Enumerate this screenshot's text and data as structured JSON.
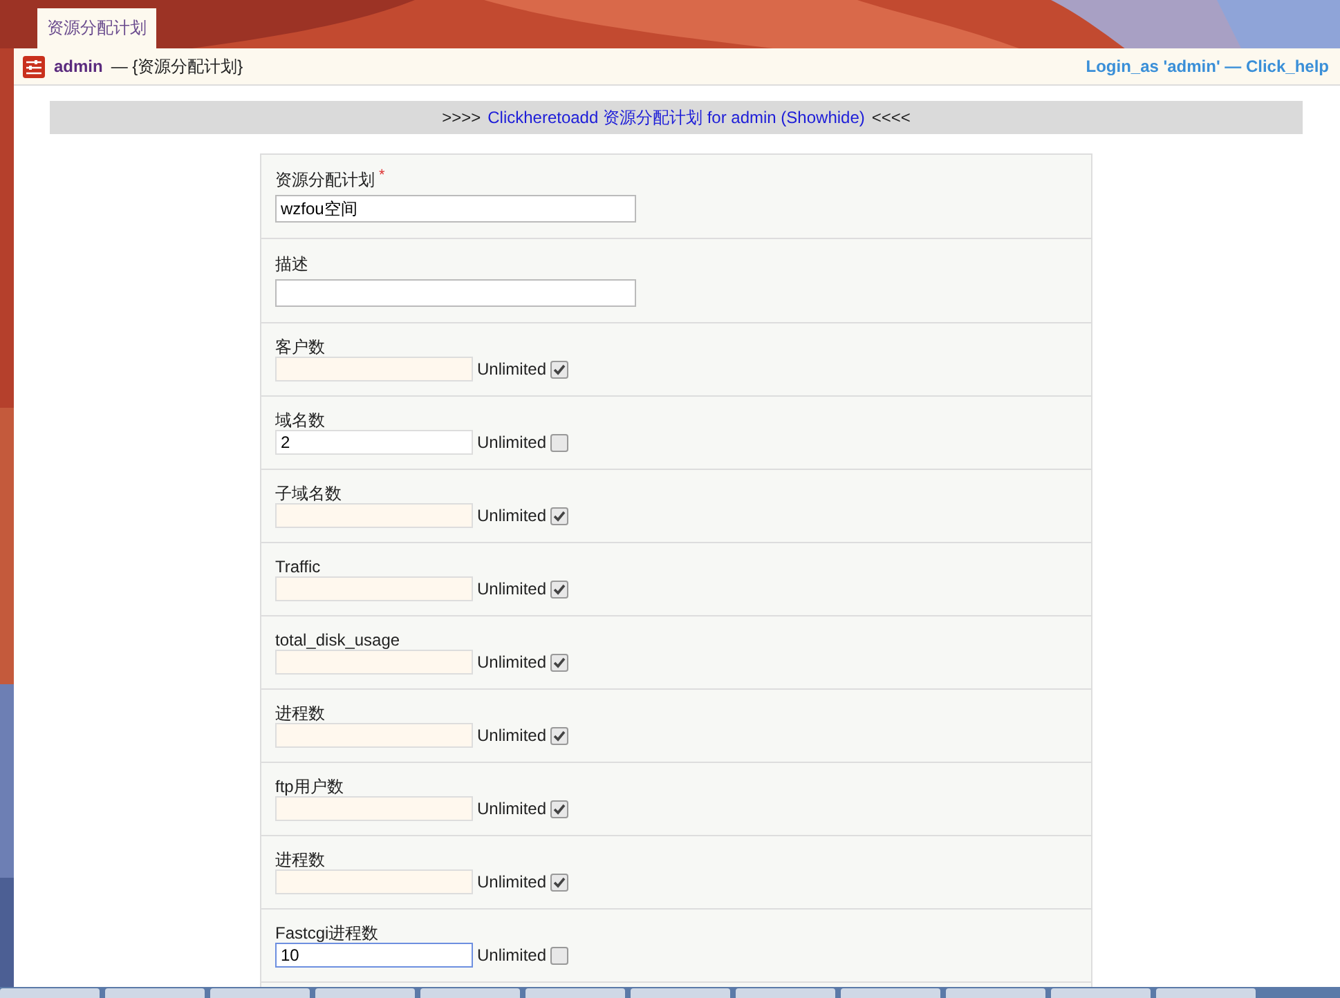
{
  "tab": {
    "label": "资源分配计划",
    "selected": true
  },
  "header": {
    "user": "admin",
    "title": " — {资源分配计划}",
    "links": "Login_as 'admin' — Click_help"
  },
  "banner": {
    "prefix": ">>>>",
    "link": "Clickheretoadd 资源分配计划 for admin (Showhide)",
    "suffix": "<<<<"
  },
  "fields": [
    {
      "kind": "text",
      "label": "资源分配计划",
      "required_mark": "*",
      "value": "wzfou空间"
    },
    {
      "kind": "text",
      "label": "描述"
    },
    {
      "kind": "limit",
      "label": "客户数",
      "unlimited_label": "Unlimited",
      "unlimited": true,
      "focused": false
    },
    {
      "kind": "limit",
      "label": "域名数",
      "value": "2",
      "unlimited_label": "Unlimited",
      "unlimited": false,
      "focused": false
    },
    {
      "kind": "limit",
      "label": "子域名数",
      "unlimited_label": "Unlimited",
      "unlimited": true,
      "focused": false
    },
    {
      "kind": "limit",
      "label": "Traffic",
      "unlimited_label": "Unlimited",
      "unlimited": true,
      "focused": false
    },
    {
      "kind": "limit",
      "label": "total_disk_usage",
      "unlimited_label": "Unlimited",
      "unlimited": true,
      "focused": false
    },
    {
      "kind": "limit",
      "label": "进程数",
      "unlimited_label": "Unlimited",
      "unlimited": true,
      "focused": false
    },
    {
      "kind": "limit",
      "label": "ftp用户数",
      "unlimited_label": "Unlimited",
      "unlimited": true,
      "focused": false
    },
    {
      "kind": "limit",
      "label": "进程数",
      "unlimited_label": "Unlimited",
      "unlimited": true,
      "focused": false
    },
    {
      "kind": "limit",
      "label": "Fastcgi进程数",
      "value": "10",
      "unlimited_label": "Unlimited",
      "unlimited": false,
      "focused": true
    }
  ]
}
